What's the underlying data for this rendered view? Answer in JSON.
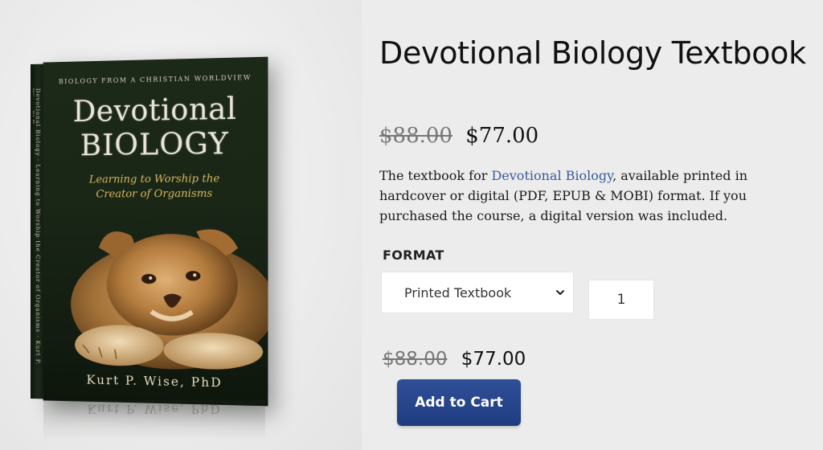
{
  "book": {
    "top_line": "BIOLOGY FROM A CHRISTIAN WORLDVIEW",
    "title_line1": "Devotional",
    "title_line2": "BIOLOGY",
    "subtitle_line1": "Learning to Worship the",
    "subtitle_line2": "Creator of Organisms",
    "author": "Kurt P. Wise, PhD",
    "spine_text": "Devotional Biology · Learning to Worship the Creator of Organisms · Kurt P. Wise, PhD"
  },
  "product": {
    "title": "Devotional Biology Textbook",
    "price_old": "$88.00",
    "price_new": "$77.00",
    "description_before": "The textbook for ",
    "description_link": "Devotional Biology",
    "description_after": ", available printed in hardcover or digital (PDF, EPUB & MOBI) format.  If you purchased the course, a digital version was included."
  },
  "options": {
    "format_label": "FORMAT",
    "format_selected": "Printed Textbook",
    "quantity": "1"
  },
  "cart": {
    "price_old": "$88.00",
    "price_new": "$77.00",
    "button_label": "Add to Cart"
  },
  "colors": {
    "accent_link": "#3a5a9a",
    "button": "#254488",
    "cover_green": "#1a2616",
    "subtitle_gold": "#d8b860"
  },
  "icons": {
    "select_chevron": "chevron-down-icon"
  }
}
